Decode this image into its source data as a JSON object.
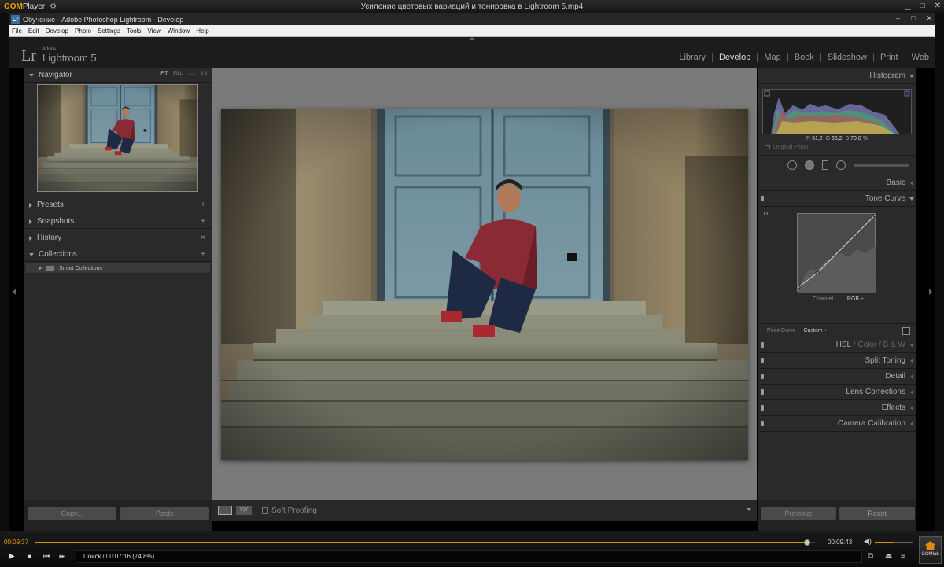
{
  "gom": {
    "logo_bold": "GOM",
    "logo_rest": "Player",
    "window_title": "Усиление цветовых вариаций и тонировка в Lightroom 5.mp4",
    "btn_minimize": "▁",
    "btn_maximize": "□",
    "btn_close": "✕"
  },
  "app_window": {
    "icon_letter": "Lr",
    "title": "Обучение - Adobe Photoshop Lightroom - Develop",
    "btn_minimize": "–",
    "btn_maximize": "□",
    "btn_close": "✕"
  },
  "menu": [
    "File",
    "Edit",
    "Develop",
    "Photo",
    "Settings",
    "Tools",
    "View",
    "Window",
    "Help"
  ],
  "lightroom": {
    "logo": "Lr",
    "brand_small": "Adobe",
    "brand": "Lightroom 5",
    "modules": [
      "Library",
      "Develop",
      "Map",
      "Book",
      "Slideshow",
      "Print",
      "Web"
    ],
    "active_module": "Develop"
  },
  "left_panel": {
    "navigator": {
      "label": "Navigator",
      "options": [
        "FIT",
        "FILL",
        "1:1",
        "1:8"
      ]
    },
    "presets": "Presets",
    "snapshots": "Snapshots",
    "history": "History",
    "collections": "Collections",
    "smart_collections": "Smart Collections",
    "copy_btn": "Copy...",
    "paste_btn": "Paste"
  },
  "toolbar": {
    "yy_label": "Y|Y",
    "soft_proofing": "Soft Proofing"
  },
  "right_panel": {
    "histogram": "Histogram",
    "rgb": {
      "r_label": "R",
      "r": "61,2",
      "g_label": "G",
      "g": "66,2",
      "b_label": "B",
      "b": "70,0",
      "unit": "%"
    },
    "original_photo": "Original Photo",
    "basic": "Basic",
    "tone_curve": "Tone Curve",
    "channel_label": "Channel :",
    "channel_value": "RGB ÷",
    "point_curve_label": "Point Curve :",
    "point_curve_value": "Custom ÷",
    "hsl": "HSL",
    "hsl_sep": "/",
    "color": "Color",
    "bw": "B & W",
    "split_toning": "Split Toning",
    "detail": "Detail",
    "lens_corrections": "Lens Corrections",
    "effects": "Effects",
    "camera_calibration": "Camera Calibration",
    "previous_btn": "Previous",
    "reset_btn": "Reset"
  },
  "player": {
    "time_current": "00:09:37",
    "time_total": "00:09:43",
    "progress": 0.99,
    "volume": 0.5,
    "status": "Поиск / 00:07:16 (74.8%)",
    "gomlab": "GOMlab"
  },
  "colors": {
    "accent": "#d89010",
    "panel_bg": "#2a2a2a",
    "center_bg": "#7a7a7a"
  }
}
